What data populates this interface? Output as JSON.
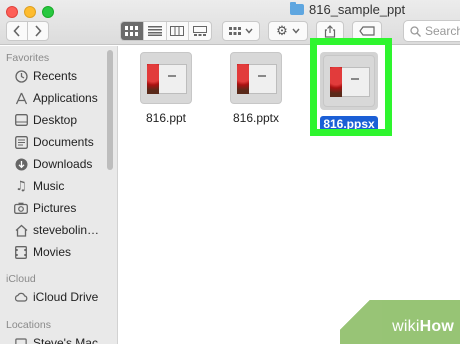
{
  "window": {
    "title": "816_sample_ppt",
    "search_placeholder": "Search"
  },
  "toolbar": {
    "back_icon": "chevron-left-icon",
    "forward_icon": "chevron-right-icon",
    "views": [
      "icon-view",
      "list-view",
      "column-view",
      "gallery-view"
    ],
    "active_view": "icon-view"
  },
  "sidebar": {
    "sections": [
      {
        "heading": "Favorites",
        "items": [
          {
            "label": "Recents",
            "icon": "clock-icon"
          },
          {
            "label": "Applications",
            "icon": "applications-icon"
          },
          {
            "label": "Desktop",
            "icon": "desktop-icon"
          },
          {
            "label": "Documents",
            "icon": "document-icon"
          },
          {
            "label": "Downloads",
            "icon": "download-icon"
          },
          {
            "label": "Music",
            "icon": "music-icon"
          },
          {
            "label": "Pictures",
            "icon": "camera-icon"
          },
          {
            "label": "stevebolin…",
            "icon": "home-icon"
          },
          {
            "label": "Movies",
            "icon": "film-icon"
          }
        ]
      },
      {
        "heading": "iCloud",
        "items": [
          {
            "label": "iCloud Drive",
            "icon": "cloud-icon"
          }
        ]
      },
      {
        "heading": "Locations",
        "items": [
          {
            "label": "Steve's Mac",
            "icon": "laptop-icon"
          }
        ]
      }
    ]
  },
  "files": [
    {
      "name": "816.ppt",
      "selected": false
    },
    {
      "name": "816.pptx",
      "selected": false
    },
    {
      "name": "816.ppsx",
      "selected": true
    }
  ],
  "watermark": {
    "prefix": "wiki",
    "suffix": "How"
  },
  "colors": {
    "selection": "#1b5fd6",
    "highlight": "#2ef52e",
    "watermark": "#8fbf6a"
  }
}
